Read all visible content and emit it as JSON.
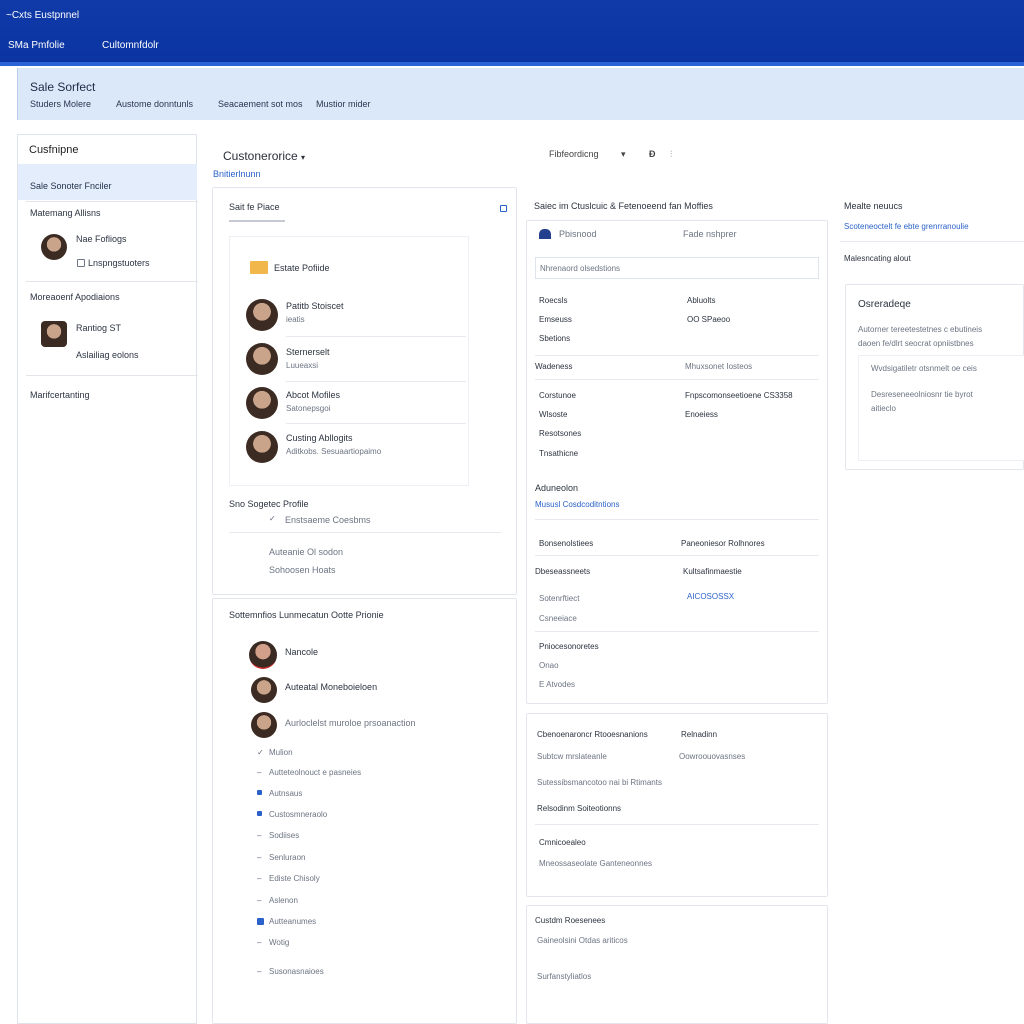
{
  "topbar": {
    "app_title": "~Cxts Eustpnnel",
    "nav": [
      "SMa Pmfolie",
      "Cultomnfdolr"
    ]
  },
  "subheader": {
    "title": "Sale Sorfect",
    "tabs": [
      "Studers Molere",
      "Austome donntunls",
      "Seacaement sot mos",
      "Mustior mider"
    ]
  },
  "sidebar": {
    "title": "Cusfnipne",
    "active_item": "Sale Sonoter Fnciler",
    "section1": "Matemang Allisns",
    "person1_name": "Nae Fofliogs",
    "person1_sub": "Lnspngstuoters",
    "section2": "Moreaoenf Apodiaions",
    "person2_name": "Rantiog ST",
    "person2_sub": "Aslailiag eolons",
    "section3": "Marifcertanting"
  },
  "middle": {
    "header": "Custonerorice",
    "link": "Bnitierlnunn",
    "toolbar_select": "Fibfeordicng",
    "toolbar_icons": [
      "arrow-drop-icon",
      "export-icon",
      "options-icon"
    ],
    "panel1": {
      "title": "Sait fe Piace",
      "folder_label": "Estate Pofiide",
      "people": [
        {
          "name": "Patitb Stoiscet",
          "sub": "ieatis"
        },
        {
          "name": "Sternerselt",
          "sub": "Luueaxsi"
        },
        {
          "name": "Abcot Mofiles",
          "sub": "Satonepsgoi"
        },
        {
          "name": "Custing Abllogits",
          "sub": "Aditkobs. Sesuaartiopaimo"
        }
      ],
      "sub_title": "Sno Sogetec Profile",
      "sub_line1": "Enstsaeme Coesbms",
      "sub_line2": "Auteanie Ol sodon",
      "sub_line3": "Sohoosen Hoats"
    },
    "panel2": {
      "title": "Sottemnfios Lunmecatun  Ootte Prionie",
      "people": [
        {
          "name": "Nancole"
        },
        {
          "name": "Auteatal Moneboieloen"
        },
        {
          "name": "Aurloclelst muroloe prsoanaction"
        }
      ],
      "list": [
        "Mulion",
        "Autteteolnouct e pasneies",
        "Autnsaus",
        "Custosmneraolo",
        "Sodiises",
        "Senluraon",
        "Ediste Chisoly",
        "Aslenon",
        "Autteanumes",
        "Wotig",
        "Susonasnaioes"
      ]
    }
  },
  "detail": {
    "title": "Saiec im Ctuslcuic & Fetenoeend fan Moffies",
    "row1_left": "Pbisnood",
    "row1_right": "Fade nshprer",
    "field_value": "Nhrenaord olsedstions",
    "pairs": [
      {
        "l": "Roecsls",
        "r": "Abluolts"
      },
      {
        "l": "Emseuss",
        "r": "OO SPaeoo"
      },
      {
        "l": "Sbetions",
        "r": ""
      }
    ],
    "w_left": "Wadeness",
    "w_right": "Mhuxsonet Iosteos",
    "pairs2": [
      {
        "l": "Corstunoe",
        "r": "Fnpscomonseetioene CS3358"
      },
      {
        "l": "Wlsoste",
        "r": "Enoeiess"
      },
      {
        "l": "Resotsones",
        "r": ""
      },
      {
        "l": "Tnsathicne",
        "r": ""
      }
    ],
    "adv_title": "Aduneolon",
    "adv_link": "Mususl Cosdcoditntions",
    "pairs3": [
      {
        "l": "Bonsenolstiees",
        "r": "Paneoniesor Rolhnores"
      },
      {
        "l": "Dbeseassneets",
        "r": "Kultsafinmaestie"
      },
      {
        "l": "Sotenrftiect",
        "r": "AICOSOSSX"
      }
    ],
    "lines3": [
      "Csneeiace",
      "Pniocesonoretes",
      "Onao",
      "E Atvodes"
    ],
    "p2_head_l": "Cbenoenaroncr Rtooesnanions",
    "p2_head_r": "Relnadinn",
    "p2_line1_l": "Subtcw mrslateanle",
    "p2_line1_r": "Oowroouovasnses",
    "p2_line2": "Sutessibsmancotoo nai bi Rtimants",
    "p2_line3": "Relsodinm Soiteotionns",
    "p2_line4": "Cmnicoealeo",
    "p2_line5": "Mneossaseolate Ganteneonnes",
    "p3_title": "Custdm Roesenees",
    "p3_line1": "Gaineolsini Otdas ariticos",
    "p3_line2": "Surfanstyliatlos"
  },
  "right": {
    "title": "Mealte neuucs",
    "link": "Scoteneoctelt fe ebte grenrranoulie",
    "section": "Malesncating alout",
    "card_title": "Osreradeqe",
    "card_lines": [
      "Autorner tereetestetnes c ebutineis",
      "daoen fe/dlrt seocrat opniistbnes"
    ],
    "sub_lines": [
      "Wvdsigatiletr otsnmelt oe ceis",
      "Desreseneeolniosnr tie byrot",
      "aitieclo"
    ]
  }
}
